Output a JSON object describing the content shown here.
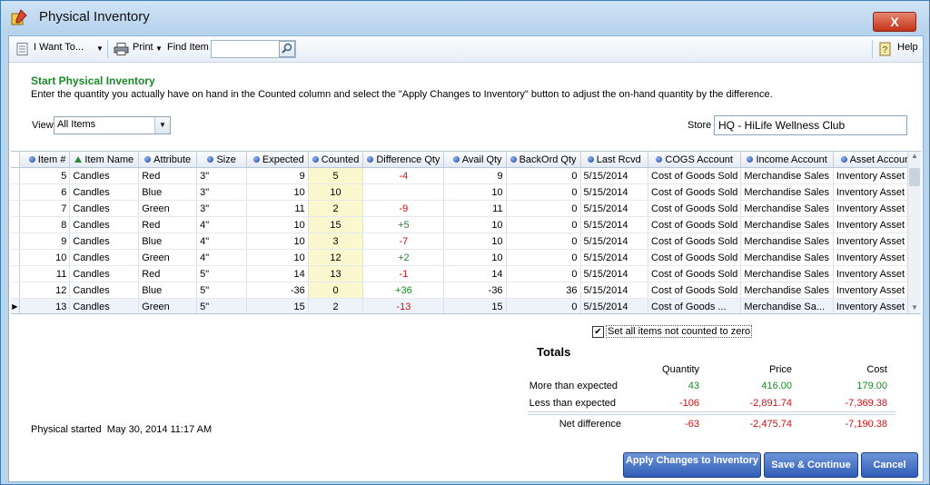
{
  "window": {
    "title": "Physical Inventory",
    "close": "X"
  },
  "toolbar": {
    "i_want_to": "I Want To...",
    "print": "Print",
    "find_item": "Find Item",
    "help": "Help"
  },
  "header": {
    "heading": "Start Physical Inventory",
    "description": "Enter the quantity you actually have on hand in the Counted column and select the \"Apply Changes to Inventory\" button to adjust the on-hand quantity by the difference.",
    "view_label": "View",
    "view_value": "All Items",
    "store_label": "Store",
    "store_value": "HQ - HiLife Wellness Club"
  },
  "grid": {
    "columns": [
      "Item #",
      "Item Name",
      "Attribute",
      "Size",
      "Expected",
      "Counted",
      "Difference Qty",
      "Avail Qty",
      "BackOrd Qty",
      "Last Rcvd",
      "COGS Account",
      "Income Account",
      "Asset Account"
    ],
    "rows": [
      [
        "5",
        "Candles",
        "Red",
        "3\"",
        "9",
        "5",
        "-4",
        "9",
        "0",
        "5/15/2014",
        "Cost of Goods Sold",
        "Merchandise Sales",
        "Inventory Asset"
      ],
      [
        "6",
        "Candles",
        "Blue",
        "3\"",
        "10",
        "10",
        "",
        "10",
        "0",
        "5/15/2014",
        "Cost of Goods Sold",
        "Merchandise Sales",
        "Inventory Asset"
      ],
      [
        "7",
        "Candles",
        "Green",
        "3\"",
        "11",
        "2",
        "-9",
        "11",
        "0",
        "5/15/2014",
        "Cost of Goods Sold",
        "Merchandise Sales",
        "Inventory Asset"
      ],
      [
        "8",
        "Candles",
        "Red",
        "4\"",
        "10",
        "15",
        "+5",
        "10",
        "0",
        "5/15/2014",
        "Cost of Goods Sold",
        "Merchandise Sales",
        "Inventory Asset"
      ],
      [
        "9",
        "Candles",
        "Blue",
        "4\"",
        "10",
        "3",
        "-7",
        "10",
        "0",
        "5/15/2014",
        "Cost of Goods Sold",
        "Merchandise Sales",
        "Inventory Asset"
      ],
      [
        "10",
        "Candles",
        "Green",
        "4\"",
        "10",
        "12",
        "+2",
        "10",
        "0",
        "5/15/2014",
        "Cost of Goods Sold",
        "Merchandise Sales",
        "Inventory Asset"
      ],
      [
        "11",
        "Candles",
        "Red",
        "5\"",
        "14",
        "13",
        "-1",
        "14",
        "0",
        "5/15/2014",
        "Cost of Goods Sold",
        "Merchandise Sales",
        "Inventory Asset"
      ],
      [
        "12",
        "Candles",
        "Blue",
        "5\"",
        "-36",
        "0",
        "+36",
        "-36",
        "36",
        "5/15/2014",
        "Cost of Goods Sold",
        "Merchandise Sales",
        "Inventory Asset"
      ],
      [
        "13",
        "Candles",
        "Green",
        "5\"",
        "15",
        "2",
        "-13",
        "15",
        "0",
        "5/15/2014",
        "Cost of Goods ...",
        "Merchandise Sa...",
        "Inventory Asset"
      ]
    ]
  },
  "options": {
    "zero_uncounted": "Set all items not counted to zero",
    "zero_uncounted_checked": true
  },
  "totals": {
    "title": "Totals",
    "headers": {
      "quantity": "Quantity",
      "price": "Price",
      "cost": "Cost"
    },
    "more": {
      "label": "More than expected",
      "quantity": "43",
      "price": "416.00",
      "cost": "179.00"
    },
    "less": {
      "label": "Less than expected",
      "quantity": "-106",
      "price": "-2,891.74",
      "cost": "-7,369.38"
    },
    "net": {
      "label": "Net difference",
      "quantity": "-63",
      "price": "-2,475.74",
      "cost": "-7,190.38"
    }
  },
  "footer": {
    "physical_started_label": "Physical started",
    "physical_started_value": "May 30, 2014 11:17 AM",
    "apply_button": "Apply Changes to Inventory",
    "save_button": "Save & Continue",
    "cancel_button": "Cancel"
  },
  "colors": {
    "positive": "#1b8a29",
    "negative": "#cc1212",
    "heading": "#1b8a29",
    "button": "#2f5db6"
  }
}
